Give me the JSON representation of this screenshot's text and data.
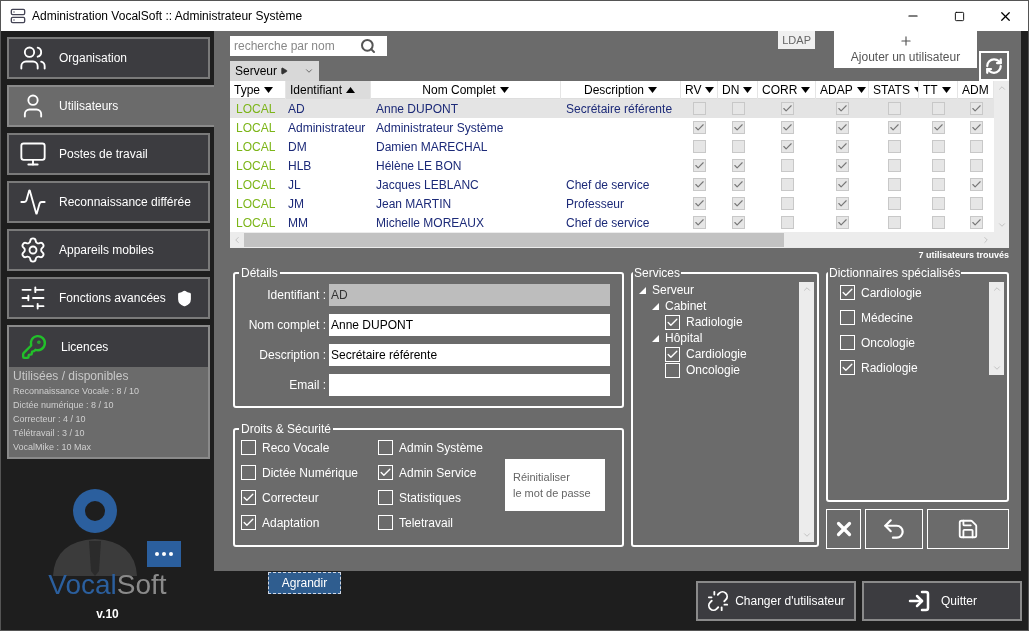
{
  "window": {
    "title": "Administration VocalSoft :: Administrateur Système"
  },
  "sidebar": {
    "items": [
      {
        "label": "Organisation",
        "selected": false
      },
      {
        "label": "Utilisateurs",
        "selected": true
      },
      {
        "label": "Postes de travail",
        "selected": false
      },
      {
        "label": "Reconnaissance différée",
        "selected": false
      },
      {
        "label": "Appareils mobiles",
        "selected": false
      },
      {
        "label": "Fonctions avancées",
        "selected": false
      }
    ]
  },
  "licences": {
    "title": "Licences",
    "subtitle": "Utilisées / disponibles",
    "lines": [
      "Reconnaissance Vocale : 8 / 10",
      "Dictée numérique : 8 / 10",
      "Correcteur : 4 / 10",
      "Télétravail : 3 / 10",
      "VocalMike : 10 Max"
    ]
  },
  "logo": {
    "wordmark": [
      "Vocal",
      "Soft"
    ],
    "version": "v.10"
  },
  "search": {
    "placeholder": "recherche par nom"
  },
  "filter": {
    "label": "Serveur"
  },
  "ldap_tab": "LDAP",
  "add_user_button": "Ajouter un utilisateur",
  "table": {
    "columns": [
      {
        "label": "Type",
        "sorted": false
      },
      {
        "label": "Identifiant",
        "sorted": true
      },
      {
        "label": "Nom Complet",
        "sorted": false
      },
      {
        "label": "Description",
        "sorted": false
      },
      {
        "label": "RV",
        "sorted": false
      },
      {
        "label": "DN",
        "sorted": false
      },
      {
        "label": "CORR",
        "sorted": false
      },
      {
        "label": "ADAP",
        "sorted": false
      },
      {
        "label": "STATS",
        "sorted": false
      },
      {
        "label": "TT",
        "sorted": false
      },
      {
        "label": "ADM",
        "sorted": false
      }
    ],
    "rows": [
      {
        "type": "LOCAL",
        "id": "AD",
        "name": "Anne DUPONT",
        "description": "Secrétaire référente",
        "selected": true,
        "rights": [
          false,
          false,
          true,
          true,
          false,
          false,
          true
        ]
      },
      {
        "type": "LOCAL",
        "id": "Administrateur",
        "name": "Administrateur Système",
        "selected": false,
        "rights": [
          true,
          true,
          true,
          true,
          true,
          true,
          true
        ]
      },
      {
        "type": "LOCAL",
        "id": "DM",
        "name": "Damien MARECHAL",
        "selected": false,
        "rights": [
          false,
          false,
          true,
          true,
          false,
          false,
          false
        ]
      },
      {
        "type": "LOCAL",
        "id": "HLB",
        "name": "Hélène LE BON",
        "selected": false,
        "rights": [
          true,
          true,
          false,
          true,
          false,
          false,
          false
        ]
      },
      {
        "type": "LOCAL",
        "id": "JL",
        "name": "Jacques LEBLANC",
        "description": "Chef de service",
        "selected": false,
        "rights": [
          true,
          true,
          false,
          true,
          false,
          false,
          true
        ]
      },
      {
        "type": "LOCAL",
        "id": "JM",
        "name": "Jean MARTIN",
        "description": "Professeur",
        "selected": false,
        "rights": [
          true,
          true,
          false,
          true,
          false,
          false,
          false
        ]
      },
      {
        "type": "LOCAL",
        "id": "MM",
        "name": "Michelle MOREAUX",
        "description": "Chef de service",
        "selected": false,
        "rights": [
          true,
          true,
          false,
          true,
          false,
          false,
          true
        ]
      }
    ]
  },
  "count": "7 utilisateurs trouvés",
  "details": {
    "title": "Détails",
    "fields": [
      {
        "label": "Identifiant :",
        "value": "AD",
        "disabled": true
      },
      {
        "label": "Nom complet :",
        "value": "Anne DUPONT",
        "disabled": false
      },
      {
        "label": "Description :",
        "value": "Secrétaire référente",
        "disabled": false
      },
      {
        "label": "Email :",
        "disabled": false
      }
    ]
  },
  "rights": {
    "title": "Droits & Sécurité",
    "items": [
      {
        "label": "Reco Vocale",
        "checked": false
      },
      {
        "label": "Dictée Numérique",
        "checked": false
      },
      {
        "label": "Correcteur",
        "checked": true
      },
      {
        "label": "Adaptation",
        "checked": true
      },
      {
        "label": "Admin Système",
        "checked": false
      },
      {
        "label": "Admin Service",
        "checked": true
      },
      {
        "label": "Statistiques",
        "checked": false
      },
      {
        "label": "Teletravail",
        "checked": false
      }
    ],
    "reset_button": "Réinitialiser\nle mot de passe"
  },
  "services": {
    "title": "Services",
    "tree": [
      {
        "label": "Serveur",
        "expanded": true,
        "children": [
          {
            "label": "Cabinet",
            "expanded": true,
            "children": [
              {
                "label": "Radiologie",
                "checked": true
              }
            ]
          },
          {
            "label": "Hôpital",
            "expanded": true,
            "children": [
              {
                "label": "Cardiologie",
                "checked": true
              },
              {
                "label": "Oncologie",
                "checked": false
              }
            ]
          }
        ]
      }
    ]
  },
  "dictionaries": {
    "title": "Dictionnaires spécialisés",
    "items": [
      {
        "label": "Cardiologie",
        "checked": true
      },
      {
        "label": "Médecine",
        "checked": false
      },
      {
        "label": "Oncologie",
        "checked": false
      },
      {
        "label": "Radiologie",
        "checked": true
      }
    ]
  },
  "agrandir_button": "Agrandir",
  "change_user_button": "Changer d'utilisateur",
  "quit_button": "Quitter"
}
